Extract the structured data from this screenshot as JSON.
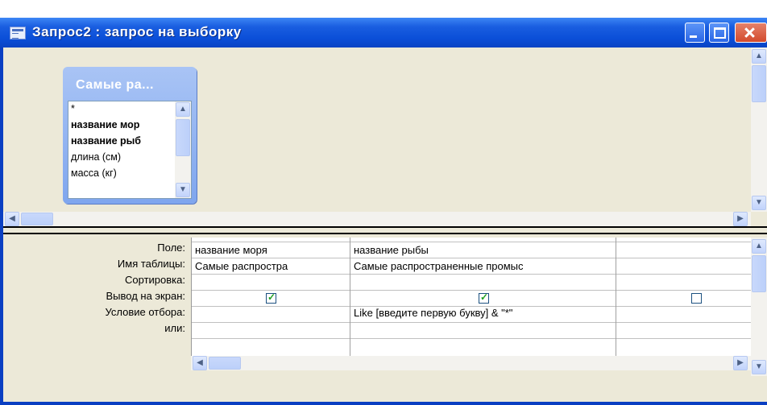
{
  "window": {
    "title": "Запрос2 : запрос на выборку"
  },
  "table_box": {
    "title": "Самые ра...",
    "fields": [
      {
        "label": "*",
        "bold": false
      },
      {
        "label": "название мор",
        "bold": true
      },
      {
        "label": "название рыб",
        "bold": true
      },
      {
        "label": "длина (см)",
        "bold": false
      },
      {
        "label": "масса (кг)",
        "bold": false
      }
    ]
  },
  "grid": {
    "row_labels": [
      "Поле:",
      "Имя таблицы:",
      "Сортировка:",
      "Вывод на экран:",
      "Условие отбора:",
      "или:"
    ],
    "columns": [
      {
        "field": "название моря",
        "table": "Самые распростра",
        "sort": "",
        "show": true,
        "criteria": "",
        "or": ""
      },
      {
        "field": "название рыбы",
        "table": "Самые распространенные промыс",
        "sort": "",
        "show": true,
        "criteria": "Like [введите первую букву] & \"*\"",
        "or": ""
      },
      {
        "field": "",
        "table": "",
        "sort": "",
        "show": false,
        "criteria": "",
        "or": ""
      }
    ]
  },
  "colors": {
    "titlebar": "#0b4fd8",
    "panel": "#ece9d8",
    "table_header": "#a9c4f5",
    "checkmark": "#21a121"
  }
}
